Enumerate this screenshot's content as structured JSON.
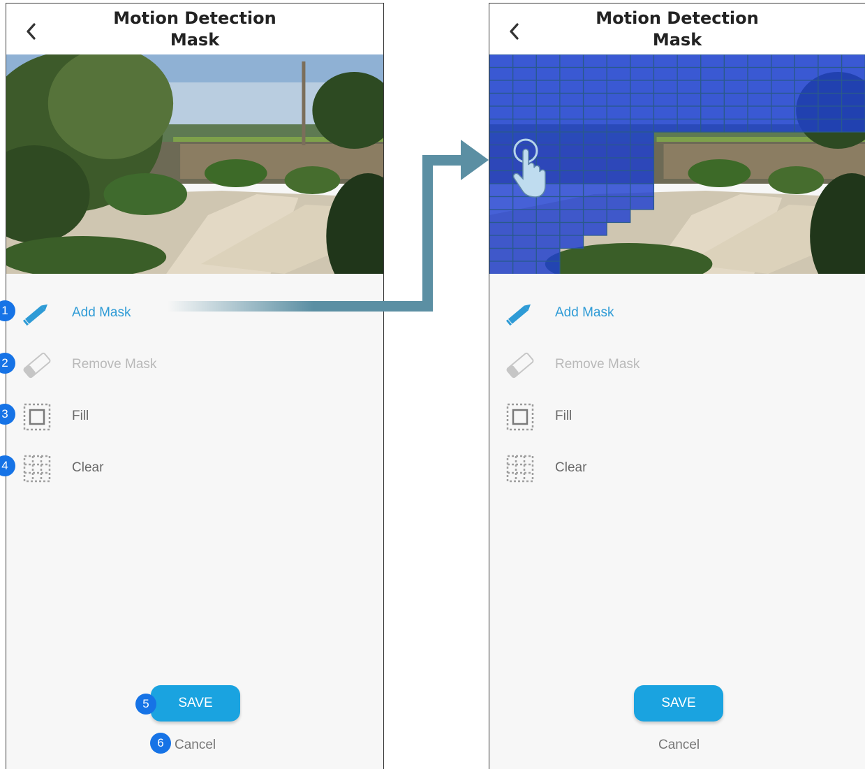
{
  "colors": {
    "accent": "#1aa3e0",
    "active_text": "#2e9bd6",
    "badge": "#1673e6",
    "mask": "#1f3fd0",
    "arrow": "#5b8fa3"
  },
  "left_screen": {
    "back_icon": "chevron-left-icon",
    "title": "Motion Detection\nMask",
    "tools": [
      {
        "label": "Add Mask",
        "icon": "pencil-icon",
        "state": "active",
        "badge": "1"
      },
      {
        "label": "Remove Mask",
        "icon": "eraser-icon",
        "state": "disabled",
        "badge": "2"
      },
      {
        "label": "Fill",
        "icon": "fill-icon",
        "state": "normal",
        "badge": "3"
      },
      {
        "label": "Clear",
        "icon": "clear-grid-icon",
        "state": "normal",
        "badge": "4"
      }
    ],
    "save_label": "SAVE",
    "save_badge": "5",
    "cancel_label": "Cancel",
    "cancel_badge": "6"
  },
  "right_screen": {
    "back_icon": "chevron-left-icon",
    "title": "Motion Detection\nMask",
    "tools": [
      {
        "label": "Add Mask",
        "icon": "pencil-icon",
        "state": "active"
      },
      {
        "label": "Remove Mask",
        "icon": "eraser-icon",
        "state": "disabled"
      },
      {
        "label": "Fill",
        "icon": "fill-icon",
        "state": "normal"
      },
      {
        "label": "Clear",
        "icon": "clear-grid-icon",
        "state": "normal"
      }
    ],
    "save_label": "SAVE",
    "cancel_label": "Cancel",
    "gesture_icon": "tap-hand-icon"
  }
}
